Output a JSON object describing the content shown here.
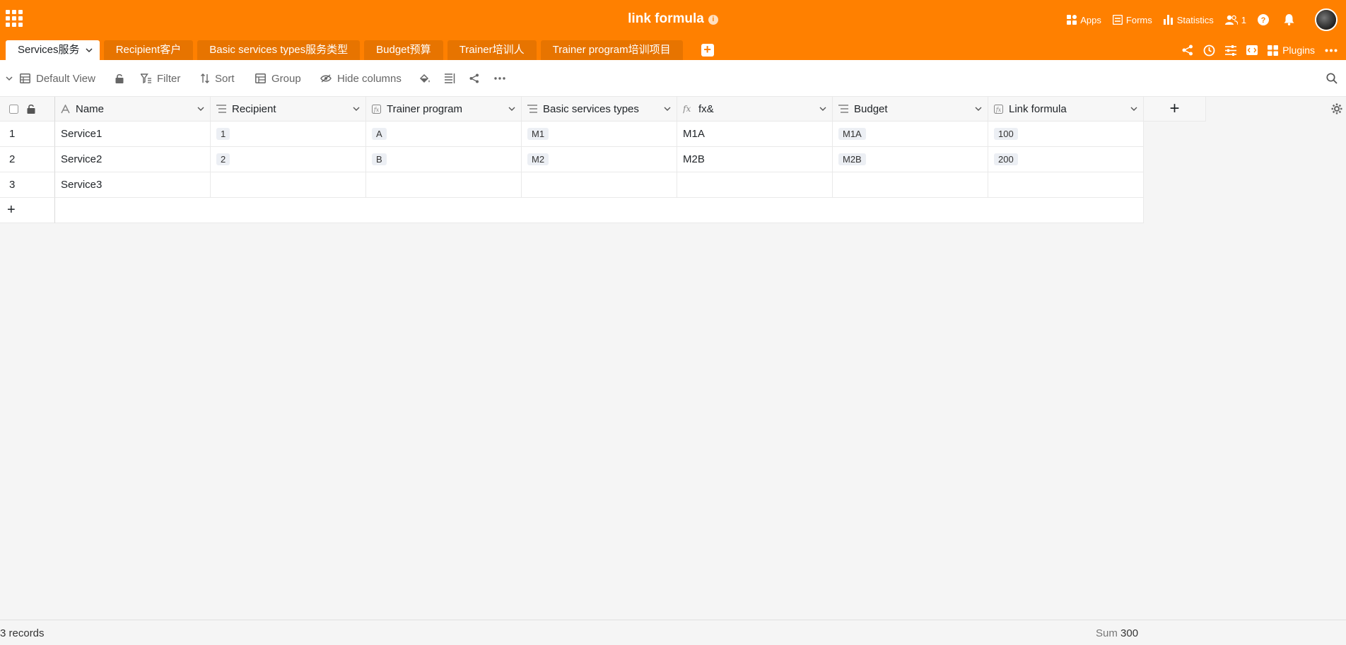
{
  "app": {
    "title": "link formula"
  },
  "topbar": [
    {
      "name": "apps",
      "label": "Apps"
    },
    {
      "name": "forms",
      "label": "Forms"
    },
    {
      "name": "statistics",
      "label": "Statistics"
    },
    {
      "name": "collaborators",
      "label": "1"
    }
  ],
  "tabs": [
    {
      "label": "Services服务",
      "active": true
    },
    {
      "label": "Recipient客户"
    },
    {
      "label": "Basic services types服务类型"
    },
    {
      "label": "Budget预算"
    },
    {
      "label": "Trainer培训人"
    },
    {
      "label": "Trainer program培训项目"
    }
  ],
  "tab_tools": {
    "plugins": "Plugins"
  },
  "toolbar": {
    "view": "Default View",
    "filter": "Filter",
    "sort": "Sort",
    "group": "Group",
    "hide_columns": "Hide columns"
  },
  "columns": [
    {
      "label": "Name",
      "icon": "text-icon"
    },
    {
      "label": "Recipient",
      "icon": "link-icon"
    },
    {
      "label": "Trainer program",
      "icon": "formula-icon"
    },
    {
      "label": "Basic services types",
      "icon": "link-icon"
    },
    {
      "label": "fx&",
      "icon": "fx-icon"
    },
    {
      "label": "Budget",
      "icon": "link-icon"
    },
    {
      "label": "Link formula",
      "icon": "formula-icon"
    }
  ],
  "rows": [
    {
      "index": "1",
      "name": "Service1",
      "recipient": "1",
      "trainer_program": "A",
      "basic_services": "M1",
      "fx": "M1A",
      "budget": "M1A",
      "link_formula": "100"
    },
    {
      "index": "2",
      "name": "Service2",
      "recipient": "2",
      "trainer_program": "B",
      "basic_services": "M2",
      "fx": "M2B",
      "budget": "M2B",
      "link_formula": "200"
    },
    {
      "index": "3",
      "name": "Service3",
      "recipient": "",
      "trainer_program": "",
      "basic_services": "",
      "fx": "",
      "budget": "",
      "link_formula": ""
    }
  ],
  "footer": {
    "records": "3 records",
    "sum_label": "Sum",
    "sum_value": "300"
  },
  "colors": {
    "brand": "#ff8000",
    "tab_inactive": "#e77400"
  }
}
